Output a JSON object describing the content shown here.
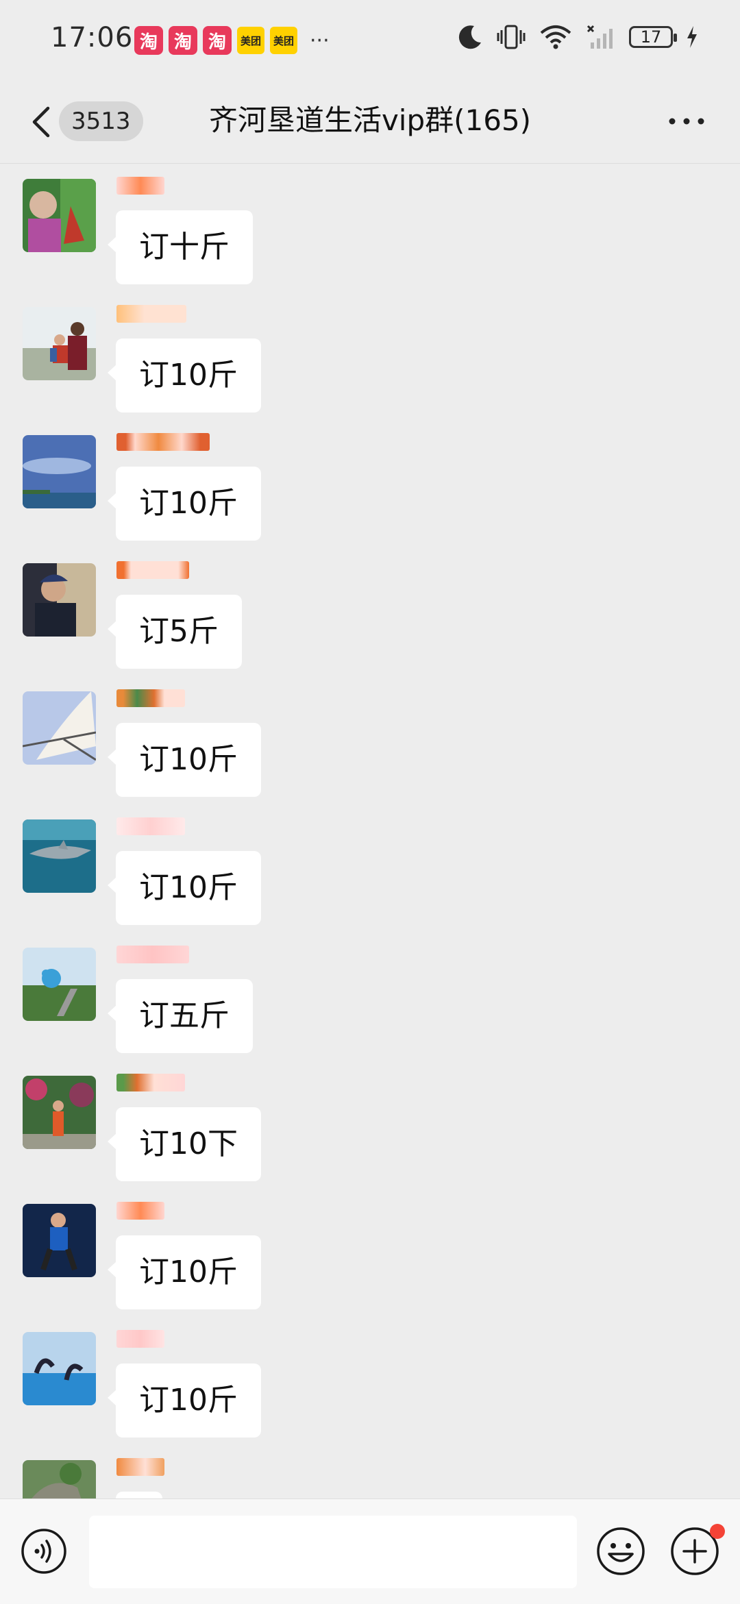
{
  "status_bar": {
    "time": "17:06",
    "apps": [
      {
        "icon": "taobao-icon",
        "label": "淘"
      },
      {
        "icon": "taobao-icon",
        "label": "淘"
      },
      {
        "icon": "taobao-icon",
        "label": "淘"
      },
      {
        "icon": "meituan-icon",
        "label": "美团"
      },
      {
        "icon": "meituan-icon",
        "label": "美团"
      }
    ],
    "more": "···",
    "battery": "17",
    "colors": {
      "taobao": "#e8395b",
      "meituan": "#ffd100"
    }
  },
  "header": {
    "unread_count": "3513",
    "title": "齐河垦道生活vip群(165)",
    "more_icon": "more-dots-icon",
    "back_icon": "back-chevron-icon"
  },
  "messages": [
    {
      "text": "订十斤",
      "avatar": "avatar-woman-garden"
    },
    {
      "text": "订10斤",
      "avatar": "avatar-grandparent-child"
    },
    {
      "text": "订10斤",
      "avatar": "avatar-sky-sea"
    },
    {
      "text": "订5斤",
      "avatar": "avatar-man-hat"
    },
    {
      "text": "订10斤",
      "avatar": "avatar-sailboat"
    },
    {
      "text": "订10斤",
      "avatar": "avatar-shark"
    },
    {
      "text": "订五斤",
      "avatar": "avatar-dolphin-statue"
    },
    {
      "text": "订10下",
      "avatar": "avatar-child-flowers"
    },
    {
      "text": "订10斤",
      "avatar": "avatar-boy-blue"
    },
    {
      "text": "订10斤",
      "avatar": "avatar-dolphin-show"
    },
    {
      "text": "",
      "avatar": "avatar-rock-garden"
    }
  ],
  "input_bar": {
    "voice_icon": "voice-icon",
    "emoji_icon": "emoji-icon",
    "plus_icon": "plus-icon",
    "accent": "#f44336"
  }
}
